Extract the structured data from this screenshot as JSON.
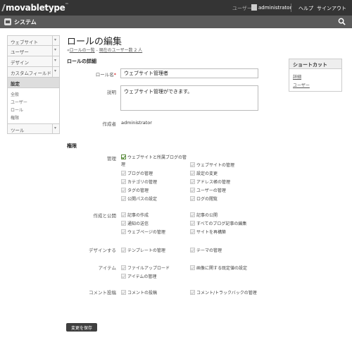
{
  "header": {
    "logo_text": "movabletype",
    "logo_tm": "™",
    "user_label": "ユーザー",
    "user_name": "administrator",
    "help": "ヘルプ",
    "signout": "サインアウト"
  },
  "system_bar": {
    "title": "システム"
  },
  "sidebar": {
    "items": [
      {
        "label": "ウェブサイト"
      },
      {
        "label": "ユーザー"
      },
      {
        "label": "デザイン"
      },
      {
        "label": "カスタムフィールド"
      },
      {
        "label": "設定"
      }
    ],
    "settings_sub": [
      {
        "label": "全般"
      },
      {
        "label": "ユーザー"
      },
      {
        "label": "ロール"
      },
      {
        "label": "権限"
      }
    ],
    "tools": {
      "label": "ツール"
    }
  },
  "page": {
    "title": "ロールの編集",
    "breadcrumb_prefix": "«",
    "breadcrumb_link": "ロールの一覧",
    "breadcrumb_sep": " - ",
    "breadcrumb_users": "現在のユーザー数 2 人",
    "section_detail": "ロールの詳細",
    "role_name_label": "ロール名",
    "role_name_required": "*",
    "role_name_value": "ウェブサイト管理者",
    "description_label": "説明",
    "description_value": "ウェブサイト管理ができます。",
    "creator_label": "作成者",
    "creator_value": "administrator",
    "section_permissions": "権限",
    "save_button": "変更を保存"
  },
  "permissions": {
    "manage": {
      "label": "管理",
      "items": [
        {
          "label": "ウェブサイトと所属ブログの管理",
          "checked": true
        },
        {
          "label": "ウェブサイトの管理",
          "checked": false
        },
        {
          "label": "ブログの管理",
          "checked": false
        },
        {
          "label": "設定の変更",
          "checked": false
        },
        {
          "label": "カテゴリの管理",
          "checked": false
        },
        {
          "label": "アドレス帳の管理",
          "checked": false
        },
        {
          "label": "タグの管理",
          "checked": false
        },
        {
          "label": "ユーザーの管理",
          "checked": false
        },
        {
          "label": "公開パスの設定",
          "checked": false
        },
        {
          "label": "ログの閲覧",
          "checked": false
        }
      ]
    },
    "create": {
      "label": "作成と公開",
      "items": [
        {
          "label": "記事の作成",
          "checked": false
        },
        {
          "label": "記事の公開",
          "checked": false
        },
        {
          "label": "通知の送信",
          "checked": false
        },
        {
          "label": "すべてのブログ記事の編集",
          "checked": false
        },
        {
          "label": "ウェブページの管理",
          "checked": false
        },
        {
          "label": "サイトを再構築",
          "checked": false
        }
      ]
    },
    "design": {
      "label": "デザインする",
      "items": [
        {
          "label": "テンプレートの管理",
          "checked": false
        },
        {
          "label": "テーマの管理",
          "checked": false
        }
      ]
    },
    "items_group": {
      "label": "アイテム",
      "items": [
        {
          "label": "ファイルアップロード",
          "checked": false
        },
        {
          "label": "画像に関する既定値の設定",
          "checked": false
        },
        {
          "label": "アイテムの管理",
          "checked": false
        }
      ]
    },
    "comment": {
      "label": "コメント投稿",
      "items": [
        {
          "label": "コメントの投稿",
          "checked": false
        },
        {
          "label": "コメント/トラックバックの管理",
          "checked": false
        }
      ]
    }
  },
  "shortcut": {
    "title": "ショートカット",
    "links": [
      {
        "label": "詳細"
      },
      {
        "label": "ユーザー"
      }
    ]
  },
  "colors": {
    "topbar": "#343434",
    "system_bar": "#5a5a5a",
    "check_green": "#3a7a1a"
  }
}
